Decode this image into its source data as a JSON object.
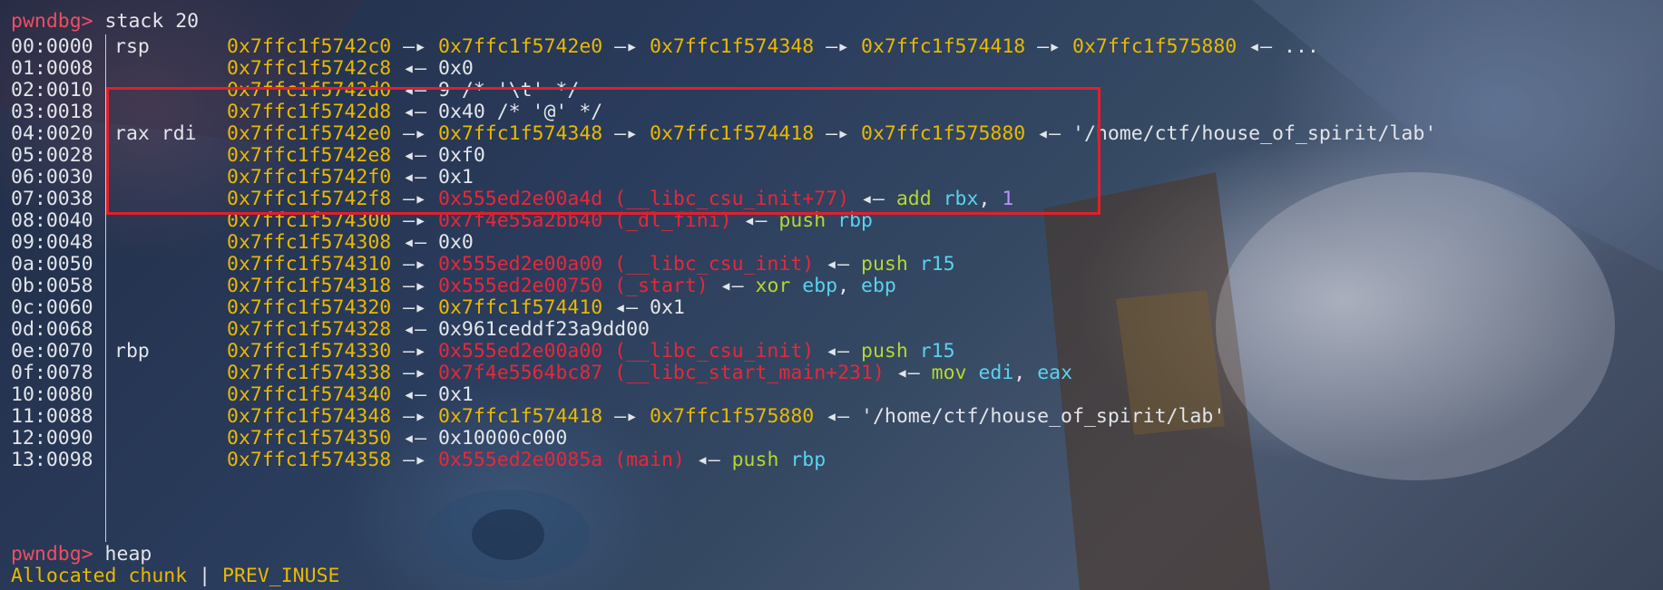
{
  "prompt": "pwndbg>",
  "command1": " stack 20",
  "command2": " heap",
  "status": {
    "chunk": "Allocated chunk",
    "sep": " | ",
    "flag": "PREV_INUSE"
  },
  "arrows": {
    "to": "—▸",
    "val": "◂—"
  },
  "rows": [
    {
      "off": "00:0000",
      "reg": "rsp",
      "parts": [
        {
          "t": "0x7ffc1f5742c0",
          "c": "y"
        },
        {
          "t": " —▸ ",
          "c": "w"
        },
        {
          "t": "0x7ffc1f5742e0",
          "c": "y"
        },
        {
          "t": " —▸ ",
          "c": "w"
        },
        {
          "t": "0x7ffc1f574348",
          "c": "y"
        },
        {
          "t": " —▸ ",
          "c": "w"
        },
        {
          "t": "0x7ffc1f574418",
          "c": "y"
        },
        {
          "t": " —▸ ",
          "c": "w"
        },
        {
          "t": "0x7ffc1f575880",
          "c": "y"
        },
        {
          "t": " ◂— ...",
          "c": "w"
        }
      ]
    },
    {
      "off": "01:0008",
      "reg": "",
      "parts": [
        {
          "t": "0x7ffc1f5742c8",
          "c": "y"
        },
        {
          "t": " ◂— 0x0",
          "c": "w"
        }
      ]
    },
    {
      "off": "02:0010",
      "reg": "",
      "parts": [
        {
          "t": "0x7ffc1f5742d0",
          "c": "y"
        },
        {
          "t": " ◂— 9 /* '\\t' */",
          "c": "w"
        }
      ]
    },
    {
      "off": "03:0018",
      "reg": "",
      "parts": [
        {
          "t": "0x7ffc1f5742d8",
          "c": "y"
        },
        {
          "t": " ◂— 0x40 /* '@' */",
          "c": "w"
        }
      ]
    },
    {
      "off": "04:0020",
      "reg": "rax rdi",
      "parts": [
        {
          "t": "0x7ffc1f5742e0",
          "c": "y"
        },
        {
          "t": " —▸ ",
          "c": "w"
        },
        {
          "t": "0x7ffc1f574348",
          "c": "y"
        },
        {
          "t": " —▸ ",
          "c": "w"
        },
        {
          "t": "0x7ffc1f574418",
          "c": "y"
        },
        {
          "t": " —▸ ",
          "c": "w"
        },
        {
          "t": "0x7ffc1f575880",
          "c": "y"
        },
        {
          "t": " ◂— '/home/ctf/house_of_spirit/lab'",
          "c": "w"
        }
      ]
    },
    {
      "off": "05:0028",
      "reg": "",
      "parts": [
        {
          "t": "0x7ffc1f5742e8",
          "c": "y"
        },
        {
          "t": " ◂— 0xf0",
          "c": "w"
        }
      ]
    },
    {
      "off": "06:0030",
      "reg": "",
      "parts": [
        {
          "t": "0x7ffc1f5742f0",
          "c": "y"
        },
        {
          "t": " ◂— 0x1",
          "c": "w"
        }
      ]
    },
    {
      "off": "07:0038",
      "reg": "",
      "parts": [
        {
          "t": "0x7ffc1f5742f8",
          "c": "y"
        },
        {
          "t": " —▸ ",
          "c": "w"
        },
        {
          "t": "0x555ed2e00a4d (__libc_csu_init+77)",
          "c": "r"
        },
        {
          "t": " ◂— ",
          "c": "w"
        },
        {
          "t": "add ",
          "c": "g"
        },
        {
          "t": "rbx",
          "c": "c"
        },
        {
          "t": ", ",
          "c": "w"
        },
        {
          "t": "1",
          "c": "m"
        }
      ]
    },
    {
      "off": "08:0040",
      "reg": "",
      "parts": [
        {
          "t": "0x7ffc1f574300",
          "c": "y"
        },
        {
          "t": " —▸ ",
          "c": "w"
        },
        {
          "t": "0x7f4e55a2bb40 (_dl_fini)",
          "c": "r"
        },
        {
          "t": " ◂— ",
          "c": "w"
        },
        {
          "t": "push ",
          "c": "g"
        },
        {
          "t": "rbp",
          "c": "c"
        }
      ]
    },
    {
      "off": "09:0048",
      "reg": "",
      "parts": [
        {
          "t": "0x7ffc1f574308",
          "c": "y"
        },
        {
          "t": " ◂— 0x0",
          "c": "w"
        }
      ]
    },
    {
      "off": "0a:0050",
      "reg": "",
      "parts": [
        {
          "t": "0x7ffc1f574310",
          "c": "y"
        },
        {
          "t": " —▸ ",
          "c": "w"
        },
        {
          "t": "0x555ed2e00a00 (__libc_csu_init)",
          "c": "r"
        },
        {
          "t": " ◂— ",
          "c": "w"
        },
        {
          "t": "push ",
          "c": "g"
        },
        {
          "t": "r15",
          "c": "c"
        }
      ]
    },
    {
      "off": "0b:0058",
      "reg": "",
      "parts": [
        {
          "t": "0x7ffc1f574318",
          "c": "y"
        },
        {
          "t": " —▸ ",
          "c": "w"
        },
        {
          "t": "0x555ed2e00750 (_start)",
          "c": "r"
        },
        {
          "t": " ◂— ",
          "c": "w"
        },
        {
          "t": "xor ",
          "c": "g"
        },
        {
          "t": "ebp",
          "c": "c"
        },
        {
          "t": ", ",
          "c": "w"
        },
        {
          "t": "ebp",
          "c": "c"
        }
      ]
    },
    {
      "off": "0c:0060",
      "reg": "",
      "parts": [
        {
          "t": "0x7ffc1f574320",
          "c": "y"
        },
        {
          "t": " —▸ ",
          "c": "w"
        },
        {
          "t": "0x7ffc1f574410",
          "c": "y"
        },
        {
          "t": " ◂— 0x1",
          "c": "w"
        }
      ]
    },
    {
      "off": "0d:0068",
      "reg": "",
      "parts": [
        {
          "t": "0x7ffc1f574328",
          "c": "y"
        },
        {
          "t": " ◂— 0x961ceddf23a9dd00",
          "c": "w"
        }
      ]
    },
    {
      "off": "0e:0070",
      "reg": "rbp",
      "parts": [
        {
          "t": "0x7ffc1f574330",
          "c": "y"
        },
        {
          "t": " —▸ ",
          "c": "w"
        },
        {
          "t": "0x555ed2e00a00 (__libc_csu_init)",
          "c": "r"
        },
        {
          "t": " ◂— ",
          "c": "w"
        },
        {
          "t": "push ",
          "c": "g"
        },
        {
          "t": "r15",
          "c": "c"
        }
      ]
    },
    {
      "off": "0f:0078",
      "reg": "",
      "parts": [
        {
          "t": "0x7ffc1f574338",
          "c": "y"
        },
        {
          "t": " —▸ ",
          "c": "w"
        },
        {
          "t": "0x7f4e5564bc87 (__libc_start_main+231)",
          "c": "r"
        },
        {
          "t": " ◂— ",
          "c": "w"
        },
        {
          "t": "mov ",
          "c": "g"
        },
        {
          "t": "edi",
          "c": "c"
        },
        {
          "t": ", ",
          "c": "w"
        },
        {
          "t": "eax",
          "c": "c"
        }
      ]
    },
    {
      "off": "10:0080",
      "reg": "",
      "parts": [
        {
          "t": "0x7ffc1f574340",
          "c": "y"
        },
        {
          "t": " ◂— 0x1",
          "c": "w"
        }
      ]
    },
    {
      "off": "11:0088",
      "reg": "",
      "parts": [
        {
          "t": "0x7ffc1f574348",
          "c": "y"
        },
        {
          "t": " —▸ ",
          "c": "w"
        },
        {
          "t": "0x7ffc1f574418",
          "c": "y"
        },
        {
          "t": " —▸ ",
          "c": "w"
        },
        {
          "t": "0x7ffc1f575880",
          "c": "y"
        },
        {
          "t": " ◂— '/home/ctf/house_of_spirit/lab'",
          "c": "w"
        }
      ]
    },
    {
      "off": "12:0090",
      "reg": "",
      "parts": [
        {
          "t": "0x7ffc1f574350",
          "c": "y"
        },
        {
          "t": " ◂— 0x10000c000",
          "c": "w"
        }
      ]
    },
    {
      "off": "13:0098",
      "reg": "",
      "parts": [
        {
          "t": "0x7ffc1f574358",
          "c": "y"
        },
        {
          "t": " —▸ ",
          "c": "w"
        },
        {
          "t": "0x555ed2e0085a (main)",
          "c": "r"
        },
        {
          "t": " ◂— ",
          "c": "w"
        },
        {
          "t": "push ",
          "c": "g"
        },
        {
          "t": "rbp",
          "c": "c"
        }
      ]
    }
  ],
  "colors": {
    "prompt": "#ef4d63",
    "address": "#e9b800",
    "symbol": "#e8273a",
    "mnemonic": "#b4d72e",
    "register": "#5ad2f0",
    "immediate": "#c08fff",
    "text": "#e2e5ea",
    "highlight_box": "#e0202d"
  }
}
